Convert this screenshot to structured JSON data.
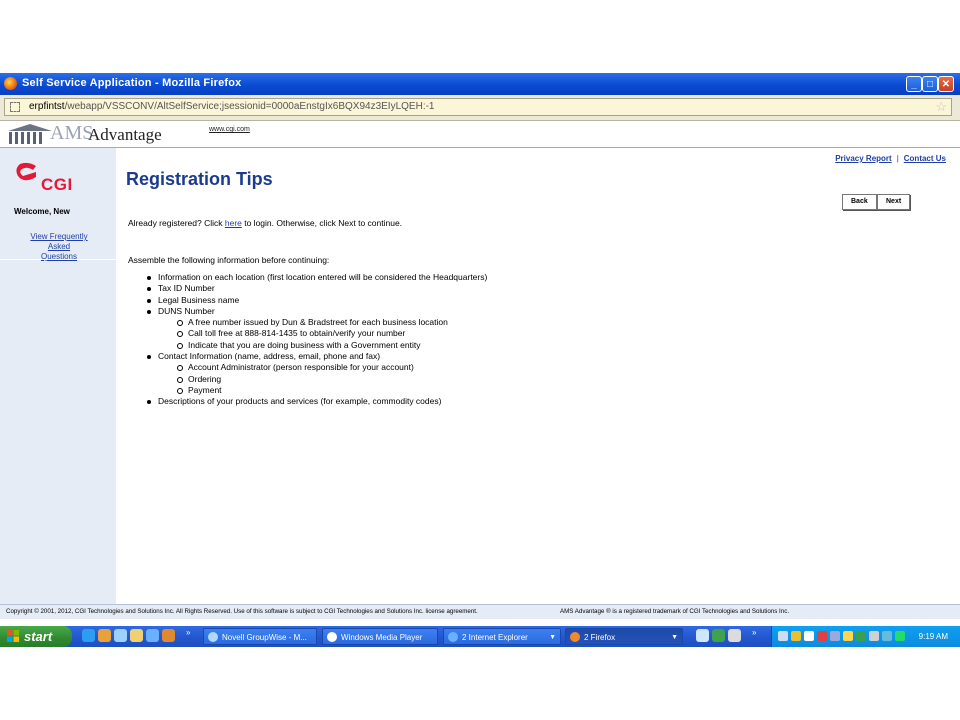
{
  "window": {
    "title": "Self Service Application - Mozilla Firefox",
    "url_host": "erpfintst",
    "url_rest": "/webapp/VSSCONV/AltSelfService;jsessionid=0000aEnstgIx6BQX94z3EIyLQEH:-1"
  },
  "banner": {
    "ams": "AMS",
    "advantage": "Advantage",
    "link": "www.cgi.com"
  },
  "sidebar": {
    "logo_text": "CGI",
    "welcome": "Welcome, New",
    "faq_line1": "View Frequently",
    "faq_line2": "Asked Questions"
  },
  "header": {
    "privacy": "Privacy Report",
    "separator": "|",
    "contact": "Contact Us"
  },
  "page": {
    "title": "Registration Tips",
    "back_label": "Back",
    "next_label": "Next",
    "intro_before": "Already registered? Click ",
    "intro_link": "here",
    "intro_after": " to login. Otherwise, click Next to continue.",
    "assemble": "Assemble the following information before continuing:",
    "items": [
      "Information on each location (first location entered will be considered the Headquarters)",
      "Tax ID Number",
      "Legal Business name",
      "DUNS Number",
      "Contact Information (name, address, email, phone and fax)",
      "Descriptions of your products and services (for example, commodity codes)"
    ],
    "duns_sub": [
      "A free number issued by Dun & Bradstreet for each business location",
      "Call toll free at 888-814-1435 to obtain/verify your number",
      "Indicate that you are doing business with a Government entity"
    ],
    "contact_sub": [
      "Account Administrator (person responsible for your account)",
      "Ordering",
      "Payment"
    ]
  },
  "footer": {
    "copyright": "Copyright © 2001, 2012, CGI Technologies and Solutions Inc. All Rights Reserved. Use of this software is subject to CGI Technologies and Solutions Inc. license agreement.",
    "trademark": "AMS Advantage ® is a registered trademark of CGI Technologies and Solutions Inc."
  },
  "taskbar": {
    "start": "start",
    "chevron": "»",
    "tasks": [
      {
        "label": "Novell GroupWise - M..."
      },
      {
        "label": "Windows Media Player"
      },
      {
        "label": "2 Internet Explorer"
      },
      {
        "label": "2 Firefox"
      }
    ],
    "clock": "9:19 AM"
  },
  "colors": {
    "title_blue": "#1b3b8f",
    "link_blue": "#1f3ea6",
    "cgi_red": "#e31937",
    "sidebar_bg": "#e6ecf6"
  }
}
